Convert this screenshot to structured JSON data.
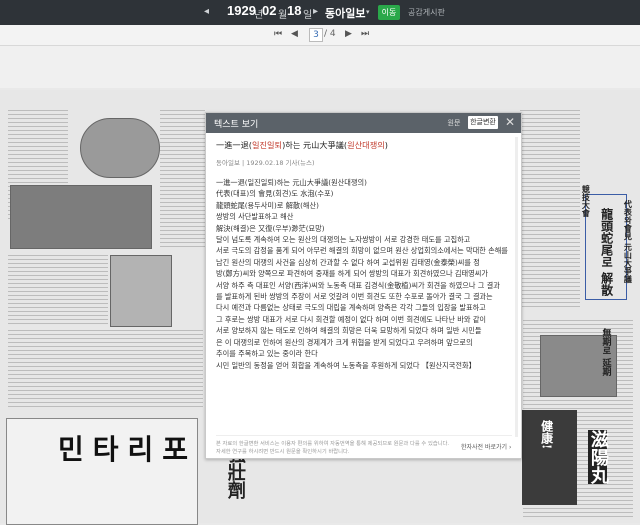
{
  "topbar": {
    "year": "1929",
    "year_unit": "년",
    "month": "02",
    "month_unit": "월",
    "day": "18",
    "day_unit": "일",
    "newspaper": "동아일보",
    "move_label": "이동",
    "notice_label": "공감게시판"
  },
  "pager": {
    "current": "3",
    "total": "/ 4",
    "first_icon": "first-page-icon",
    "prev_icon": "prev-page-icon",
    "next_icon": "next-page-icon",
    "last_icon": "last-page-icon"
  },
  "newspaper": {
    "ad_title": "민타리포",
    "vertical_headlines": [
      "代表와會見 元山大爭議",
      "龍頭蛇尾로 解散",
      "無期로 延期",
      "競技大會",
      "滋陽丸",
      "健康!",
      "強壯劑"
    ]
  },
  "dialog": {
    "title": "텍스트 보기",
    "tab_original": "원문",
    "tab_korean": "한글변환",
    "close_icon": "close-icon",
    "article_title": "一進一退(일진일퇴)하는 元山大爭議(원산대쟁의)",
    "meta": "동아일보 | 1929.02.18 기사(뉴스)",
    "lines": [
      "一進一退(일진일퇴)하는 元山大爭議(원산대쟁의)",
      "代表(대표)의 會見(회견)도 水泡(수포)",
      "龍頭蛇尾(용두사미)로 解散(해산)",
      "쌍방의 사단발표하고 해산",
      "解決(해결)은 又復(우부)渺茫(묘망)",
      "달이 넘도록 계속하여 오는 원산의 대쟁의는 노자쌍방이 서로 강경한 태도를 고집하고",
      "서로 극도의 감정을 품게 되어 아무런 해결의 희망이 없으며 원산 상업회의소에서는 막대한 손해를",
      "남긴 원산의 대쟁의 사건을 심상히 간과할 수 없다 하여 교섭위원 김태영(金泰榮)씨를 정",
      "방(鄭方)씨와 양쪽으로 파견하여 중재를 하게 되어 쌍방의 대표가 회견하였으나 김태영씨가",
      "서양 하주 측 대표인 서양(西洋)씨와 노동측 대표 김경식(金敬植)씨가 회견을 하였으나 그 결과",
      "를 발표하게 된바 쌍방의 주장이 서로 엇갈려 이번 회견도 또한 수포로 돌아가 결국 그 결과는",
      "다시 예전과 다름없는 상태로 극도의 대립을 계속하며 양측은 각각 그들의 입장을 발표하고",
      "그 후로는 쌍방 대표가 서로 다시 회견할 예정이 없다 하며 이번 회견에도 나타난 바와 같이",
      "서로 양보하지 않는 태도로 인하여 해결의 희망은 더욱 묘망하게 되었다 하며 일반 시민들",
      "은 이 대쟁의로 인하여 원산의 경제계가 크게 위협을 받게 되었다고 우려하며 앞으로의",
      "추이를 주목하고 있는 중이라 한다",
      "시민 일반의 동정을 얻어 회합을 계속하여 노동측을 후원하게 되었다 【원산지국전화】"
    ],
    "footer_note_1": "본 자료의 한글변환 서비스는 이용자 편의를 위하여 자동번역을 통해 제공되므로 원문과 다를 수 있습니다.",
    "footer_note_2": "자세한 연구를 하시려면 반드시 원문을 확인하시기 바랍니다.",
    "footer_link": "한자사전 바로가기 ›"
  }
}
